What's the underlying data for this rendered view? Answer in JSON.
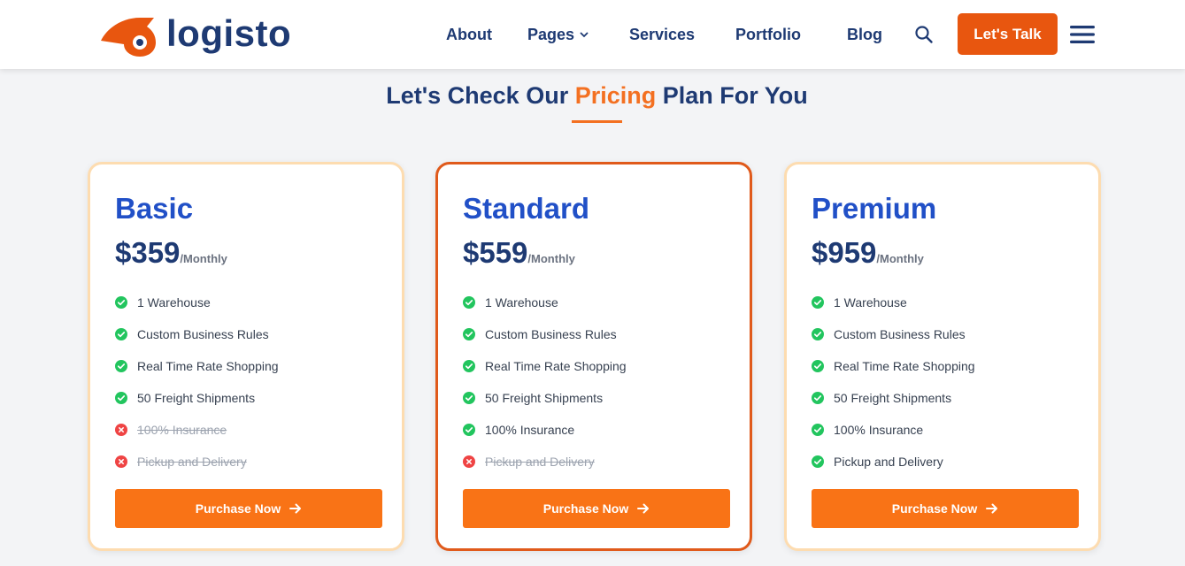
{
  "brand": {
    "name": "logisto"
  },
  "nav": {
    "items": [
      {
        "id": "about",
        "label": "About"
      },
      {
        "id": "pages",
        "label": "Pages",
        "has_dropdown": true
      },
      {
        "id": "services",
        "label": "Services"
      },
      {
        "id": "portfolio",
        "label": "Portfolio"
      },
      {
        "id": "blog",
        "label": "Blog"
      }
    ],
    "search_icon": "search-icon",
    "cta_label": "Let's Talk",
    "menu_icon": "hamburger-menu-icon"
  },
  "section": {
    "title_before": "Let's Check Our ",
    "title_accent": "Pricing",
    "title_after": " Plan For You"
  },
  "plans": [
    {
      "name": "Basic",
      "price": "$359",
      "period": "/Monthly",
      "featured": false,
      "features": [
        {
          "text": "1 Warehouse",
          "included": true
        },
        {
          "text": "Custom Business Rules",
          "included": true
        },
        {
          "text": "Real Time Rate Shopping",
          "included": true
        },
        {
          "text": "50 Freight Shipments",
          "included": true
        },
        {
          "text": "100% Insurance",
          "included": false
        },
        {
          "text": "Pickup and Delivery",
          "included": false
        }
      ],
      "button_label": "Purchase Now"
    },
    {
      "name": "Standard",
      "price": "$559",
      "period": "/Monthly",
      "featured": true,
      "features": [
        {
          "text": "1 Warehouse",
          "included": true
        },
        {
          "text": "Custom Business Rules",
          "included": true
        },
        {
          "text": "Real Time Rate Shopping",
          "included": true
        },
        {
          "text": "50 Freight Shipments",
          "included": true
        },
        {
          "text": "100% Insurance",
          "included": true
        },
        {
          "text": "Pickup and Delivery",
          "included": false
        }
      ],
      "button_label": "Purchase Now"
    },
    {
      "name": "Premium",
      "price": "$959",
      "period": "/Monthly",
      "featured": false,
      "features": [
        {
          "text": "1 Warehouse",
          "included": true
        },
        {
          "text": "Custom Business Rules",
          "included": true
        },
        {
          "text": "Real Time Rate Shopping",
          "included": true
        },
        {
          "text": "50 Freight Shipments",
          "included": true
        },
        {
          "text": "100% Insurance",
          "included": true
        },
        {
          "text": "Pickup and Delivery",
          "included": true
        }
      ],
      "button_label": "Purchase Now"
    }
  ],
  "colors": {
    "navy": "#1e3a73",
    "accent_orange": "#f37021",
    "button_orange": "#f97316",
    "cta_orange": "#e8560f",
    "plan_blue": "#2150c7",
    "check_green": "#22c55e",
    "cross_red": "#ef4444"
  }
}
